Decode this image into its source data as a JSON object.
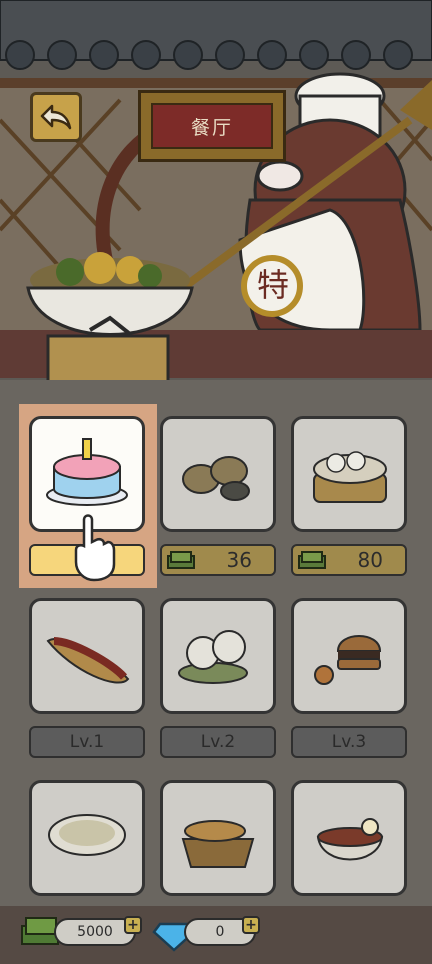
{
  "header": {
    "sign_text": "餐厅",
    "chef_badge": "特"
  },
  "items": [
    {
      "name": "cake",
      "price": "",
      "state": "selected"
    },
    {
      "name": "potatoes",
      "price": "36",
      "state": "price"
    },
    {
      "name": "steamed-buns",
      "price": "80",
      "state": "price"
    },
    {
      "name": "hotdog",
      "level": "Lv.1",
      "state": "level"
    },
    {
      "name": "rice-burger",
      "level": "Lv.2",
      "state": "level"
    },
    {
      "name": "hamburger",
      "level": "Lv.3",
      "state": "level"
    },
    {
      "name": "fried-rice",
      "state": "locked"
    },
    {
      "name": "bread-basket",
      "state": "locked"
    },
    {
      "name": "noodle-bowl",
      "state": "locked"
    }
  ],
  "currency": {
    "cash": "5000",
    "gems": "0"
  },
  "colors": {
    "sign_red": "#7d2b28",
    "gold": "#f6d67c",
    "wood": "#8a6a2a"
  }
}
